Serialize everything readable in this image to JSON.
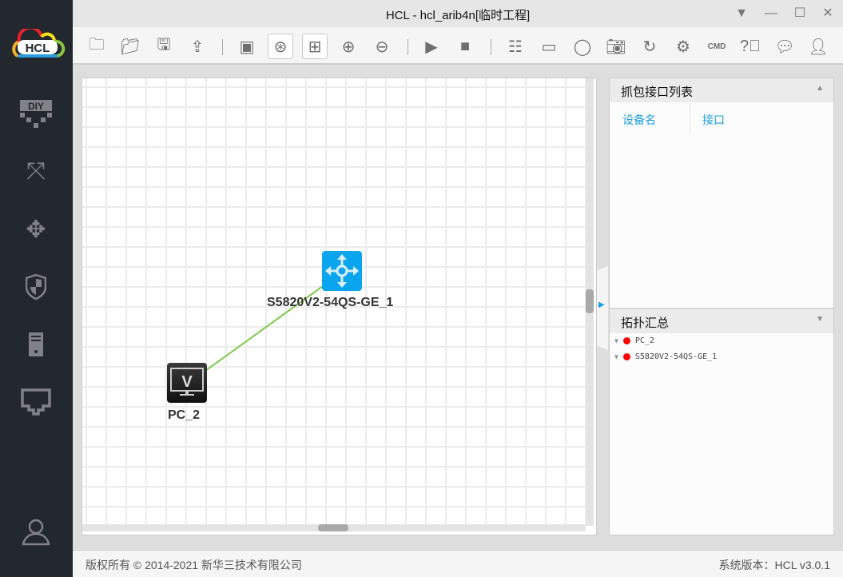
{
  "app": {
    "logo_text": "HCL",
    "title": "HCL - hcl_arib4n[临时工程]"
  },
  "sidebar": {
    "items": [
      {
        "icon": "diy-icon"
      },
      {
        "icon": "router-icon"
      },
      {
        "icon": "switch-icon"
      },
      {
        "icon": "firewall-icon"
      },
      {
        "icon": "server-icon"
      },
      {
        "icon": "interface-icon"
      },
      {
        "icon": "user-icon"
      }
    ]
  },
  "toolbar": {
    "buttons": [
      "new-project",
      "open-project",
      "save",
      "export",
      "screenshot-view",
      "topology-view",
      "grid-view",
      "zoom-in",
      "zoom-out",
      "start-all",
      "stop-all",
      "add-list",
      "add-rect",
      "add-circle",
      "camera",
      "refresh",
      "settings",
      "cmd",
      "help",
      "wechat",
      "feedback"
    ]
  },
  "topology": {
    "devices": [
      {
        "name": "S5820V2-54QS-GE_1",
        "type": "switch"
      },
      {
        "name": "PC_2",
        "type": "pc"
      }
    ],
    "link_color": "#7dc84a"
  },
  "capture_panel": {
    "title": "抓包接口列表",
    "columns": [
      "设备名",
      "接口"
    ]
  },
  "summary_panel": {
    "title": "拓扑汇总",
    "items": [
      "PC_2",
      "S5820V2-54QS-GE_1"
    ]
  },
  "footer": {
    "copyright": "版权所有 © 2014-2021 新华三技术有限公司",
    "version": "系统版本：HCL v3.0.1"
  },
  "colors": {
    "accent": "#1a9ee0",
    "switch": "#0aa4ef",
    "status_down": "#ff0000"
  }
}
